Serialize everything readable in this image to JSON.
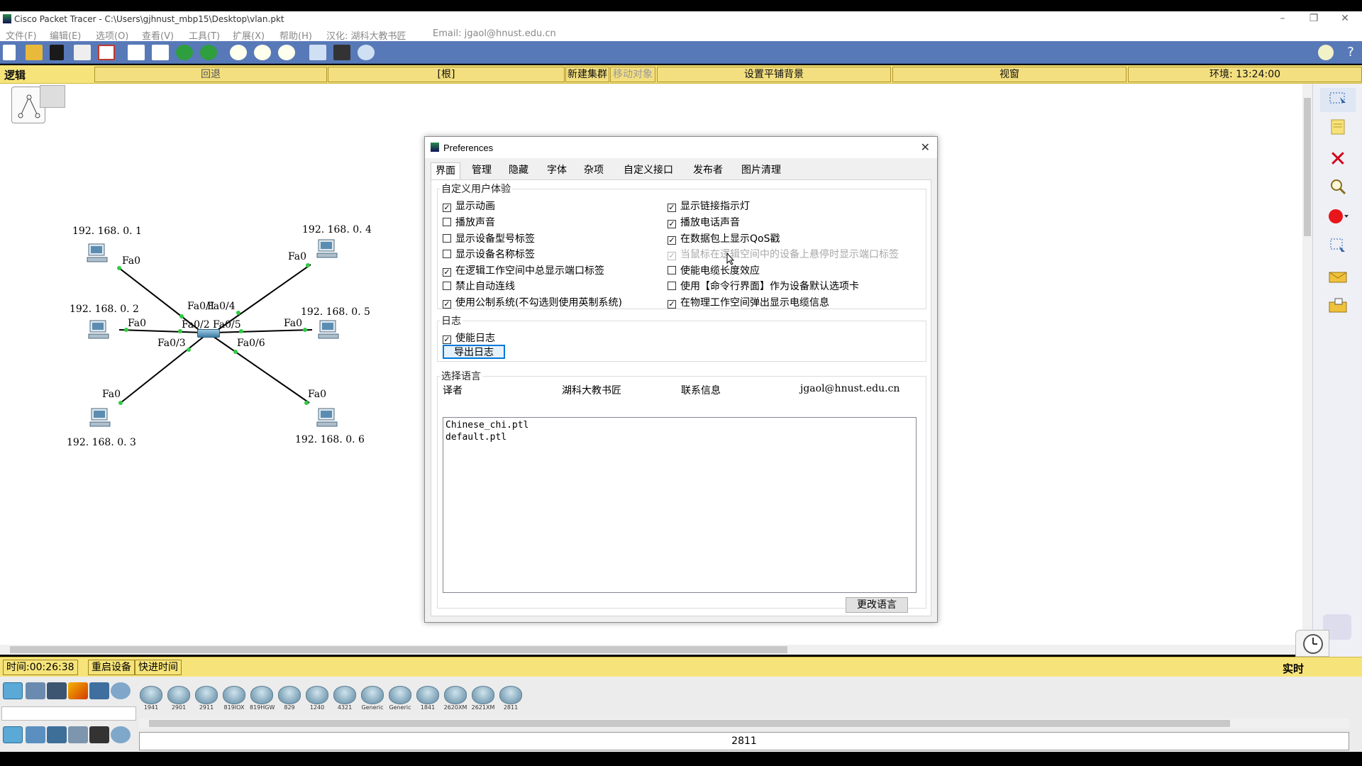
{
  "window": {
    "title": "Cisco Packet Tracer - C:\\Users\\gjhnust_mbp15\\Desktop\\vlan.pkt",
    "controls": [
      "–",
      "❐",
      "✕"
    ]
  },
  "menu": [
    "文件(F)",
    "编辑(E)",
    "选项(O)",
    "查看(V)",
    "工具(T)",
    "扩展(X)",
    "帮助(H)",
    "汉化: 湖科大教书匠",
    "Email: jgaol@hnust.edu.cn"
  ],
  "workspace_bar": {
    "logic": "逻辑",
    "back": "回退",
    "root": "[根]",
    "new_cluster": "新建集群",
    "move_object": "移动对象",
    "set_tiled_bg": "设置平铺背景",
    "viewport": "视窗",
    "environment": "环境: 13:24:00"
  },
  "network": {
    "pcs": [
      {
        "ip": "192. 168. 0. 1",
        "port": "Fa0"
      },
      {
        "ip": "192. 168. 0. 2",
        "port": "Fa0"
      },
      {
        "ip": "192. 168. 0. 3",
        "port": "Fa0"
      },
      {
        "ip": "192. 168. 0. 4",
        "port": "Fa0"
      },
      {
        "ip": "192. 168. 0. 5",
        "port": "Fa0"
      },
      {
        "ip": "192. 168. 0. 6",
        "port": "Fa0"
      }
    ],
    "switch_ports": [
      "Fa0/1",
      "Fa0/2",
      "Fa0/3",
      "Fa0/4",
      "Fa0/5",
      "Fa0/6"
    ]
  },
  "dialog": {
    "title": "Preferences",
    "close": "✕",
    "tabs": [
      "界面",
      "管理",
      "隐藏",
      "字体",
      "杂项",
      "自定义接口",
      "发布者",
      "图片清理"
    ],
    "active_tab": "界面",
    "ux_group": "自定义用户体验",
    "left_options": [
      {
        "label": "显示动画",
        "checked": true
      },
      {
        "label": "播放声音",
        "checked": false
      },
      {
        "label": "显示设备型号标签",
        "checked": false
      },
      {
        "label": "显示设备名称标签",
        "checked": false
      },
      {
        "label": "在逻辑工作空间中总显示端口标签",
        "checked": true
      },
      {
        "label": "禁止自动连线",
        "checked": false
      },
      {
        "label": "使用公制系统(不勾选则使用英制系统)",
        "checked": true
      }
    ],
    "right_options": [
      {
        "label": "显示链接指示灯",
        "checked": true
      },
      {
        "label": "播放电话声音",
        "checked": true
      },
      {
        "label": "在数据包上显示QoS戳",
        "checked": true
      },
      {
        "label": "当鼠标在逻辑空间中的设备上悬停时显示端口标签",
        "checked": true,
        "disabled": true
      },
      {
        "label": "使能电缆长度效应",
        "checked": false
      },
      {
        "label": "使用【命令行界面】作为设备默认选项卡",
        "checked": false
      },
      {
        "label": "在物理工作空间弹出显示电缆信息",
        "checked": true
      }
    ],
    "log_group": "日志",
    "enable_log": {
      "label": "使能日志",
      "checked": true
    },
    "export_log": "导出日志",
    "lang_group": "选择语言",
    "lang_headers": [
      "译者",
      "湖科大教书匠",
      "联系信息",
      "jgaol@hnust.edu.cn"
    ],
    "languages": [
      "Chinese_chi.ptl",
      "default.ptl"
    ],
    "change_language": "更改语言"
  },
  "status": {
    "time": "时间:00:26:38",
    "restart": "重启设备",
    "fast_forward": "快进时间",
    "realtime": "实时"
  },
  "devices": [
    "1941",
    "2901",
    "2911",
    "819IOX",
    "819HGW",
    "829",
    "1240",
    "4321",
    "Generic",
    "Generic",
    "1841",
    "2620XM",
    "2621XM",
    "2811"
  ],
  "selected_device": "2811",
  "colors": {
    "toolbar": "#5879b8",
    "yellow_bar": "#f6e47a",
    "link_light": "#2ecc40"
  }
}
